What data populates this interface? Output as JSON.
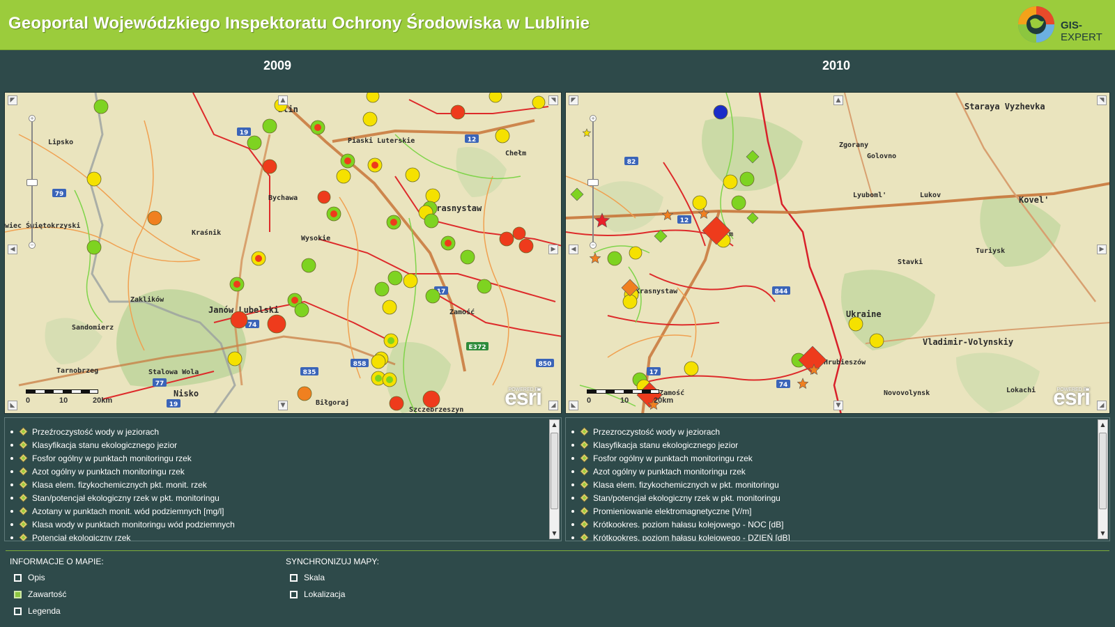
{
  "header": {
    "title": "Geoportal Wojewódzkiego Inspektoratu Ochrony Środowiska w Lublinie",
    "logo_bold": "GIS-",
    "logo_thin": "EXPERT",
    "logo_icon": "globe-logo-icon",
    "background_color": "#9bcc3c"
  },
  "maps": {
    "left": {
      "year": "2009",
      "places": [
        "blin",
        "Lipsko",
        "Piaski Luterskie",
        "Chełm",
        "Bychawa",
        "Krasnystaw",
        "Kraśnik",
        "Wysokie",
        "wiec Świętokrzyski",
        "Zaklików",
        "Janów Lubelski",
        "Zamość",
        "Sandomierz",
        "Tarnobrzeg",
        "Stalowa Wola",
        "Nisko",
        "Biłgoraj",
        "Szczebrzeszyn"
      ],
      "road_labels": [
        "19",
        "12",
        "79",
        "17",
        "74",
        "E372",
        "835",
        "858",
        "850",
        "77",
        "19"
      ],
      "scale_labels": [
        "0",
        "10",
        "20km"
      ],
      "esri_powered": "POWERED BY",
      "esri": "esri"
    },
    "right": {
      "year": "2010",
      "places": [
        "Staraya Vyzhevka",
        "Zgorany",
        "Golovno",
        "Lyuboml'",
        "Lukov",
        "Kovel'",
        "Chełm",
        "Turiysk",
        "Stavki",
        "Krasnystaw",
        "Vladimir-Volynskiy",
        "Hrubieszów",
        "Zamość",
        "Novovolynsk",
        "Lokachi",
        "Ukraine"
      ],
      "road_labels": [
        "82",
        "12",
        "844",
        "17",
        "74"
      ],
      "scale_labels": [
        "0",
        "10",
        "20km"
      ],
      "esri_powered": "POWERED BY",
      "esri": "esri"
    }
  },
  "legends": {
    "left": [
      "Przeźroczystość wody w jeziorach",
      "Klasyfikacja stanu ekologicznego jezior",
      "Fosfor ogólny w punktach monitoringu rzek",
      "Azot ogólny w punktach monitoringu rzek",
      "Klasa elem. fizykochemicznych pkt. monit. rzek",
      "Stan/potencjał ekologiczny rzek w pkt. monitoringu",
      "Azotany w punktach monit. wód podziemnych [mg/l]",
      "Klasa wody w punktach monitoringu wód podziemnych",
      "Potencjał ekologiczny rzek"
    ],
    "right": [
      "Przezroczystość wody w jeziorach",
      "Klasyfikacja stanu ekologicznego jezior",
      "Fosfor ogólny w punktach monitoringu rzek",
      "Azot ogólny w punktach monitoringu rzek",
      "Klasa elem. fizykochemicznych w pkt. monitoringu",
      "Stan/potencjał ekologiczny rzek w pkt. monitoringu",
      "Promieniowanie elektromagnetyczne [V/m]",
      "Krótkookres. poziom hałasu kolejowego - NOC [dB]",
      "Krótkookres. poziom hałasu kolejowego - DZIEŃ [dB]"
    ]
  },
  "map_info": {
    "title": "INFORMACJE O MAPIE:",
    "options": [
      {
        "label": "Opis",
        "checked": false
      },
      {
        "label": "Zawartość",
        "checked": true
      },
      {
        "label": "Legenda",
        "checked": false
      }
    ]
  },
  "sync": {
    "title": "SYNCHRONIZUJ MAPY:",
    "options": [
      {
        "label": "Skala",
        "checked": false
      },
      {
        "label": "Lokalizacja",
        "checked": false
      }
    ]
  },
  "colors": {
    "background": "#2e4a4a",
    "map_base": "#eae4be",
    "marker_green": "#7ed321",
    "marker_yellow": "#f5e100",
    "marker_orange": "#f08020",
    "marker_red": "#ee3b1c",
    "accent": "#8cc63f"
  }
}
